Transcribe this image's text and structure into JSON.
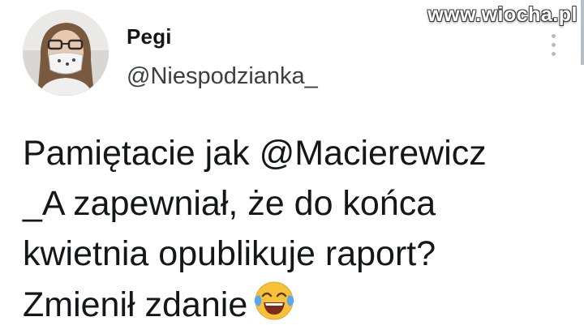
{
  "author": {
    "display_name": "Pegi",
    "handle": "@Niespodzianka_"
  },
  "watermark": "www.wiocha.pl",
  "tweet": {
    "lines": [
      "Pamiętacie jak @Macierewicz",
      "_A zapewniał, że do końca",
      "kwietnia opublikuje raport?",
      "Zmienił zdanie"
    ],
    "emoji": "face-with-tears-of-joy"
  },
  "colors": {
    "text": "#14171a",
    "handle": "#3a3f44",
    "menu_dots": "#b8bcbf",
    "emoji_face": "#f7c23a",
    "tears": "#5aa9f0"
  },
  "icons": {
    "more_menu": "more-vertical-icon",
    "avatar": "profile-photo"
  }
}
